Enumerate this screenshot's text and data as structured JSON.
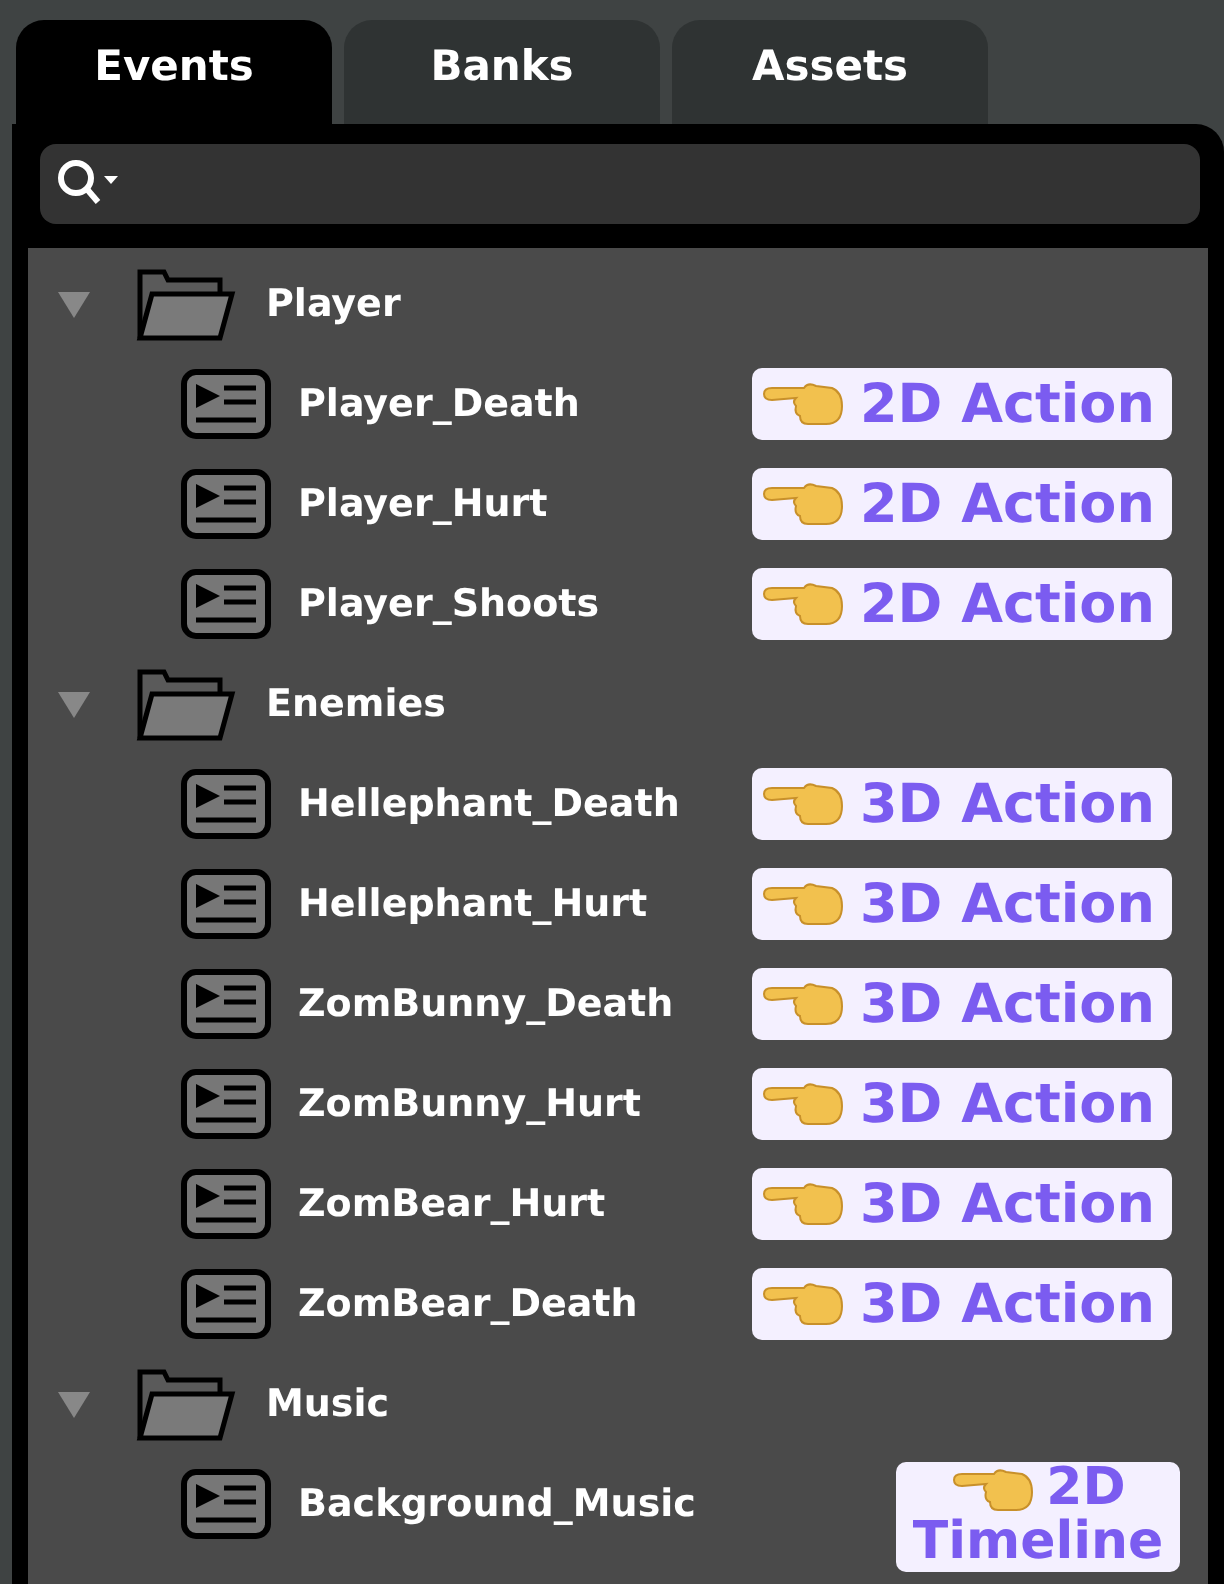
{
  "tabs": [
    {
      "label": "Events",
      "selected": true
    },
    {
      "label": "Banks",
      "selected": false
    },
    {
      "label": "Assets",
      "selected": false
    }
  ],
  "tree": [
    {
      "label": "Player",
      "expanded": true,
      "children": [
        {
          "label": "Player_Death",
          "tag": "2D Action"
        },
        {
          "label": "Player_Hurt",
          "tag": "2D Action"
        },
        {
          "label": "Player_Shoots",
          "tag": "2D Action"
        }
      ]
    },
    {
      "label": "Enemies",
      "expanded": true,
      "children": [
        {
          "label": "Hellephant_Death",
          "tag": "3D Action"
        },
        {
          "label": "Hellephant_Hurt",
          "tag": "3D Action"
        },
        {
          "label": "ZomBunny_Death",
          "tag": "3D Action"
        },
        {
          "label": "ZomBunny_Hurt",
          "tag": "3D Action"
        },
        {
          "label": "ZomBear_Hurt",
          "tag": "3D Action"
        },
        {
          "label": "ZomBear_Death",
          "tag": "3D Action"
        }
      ]
    },
    {
      "label": "Music",
      "expanded": true,
      "children": [
        {
          "label": "Background_Music",
          "tag": "2D Timeline"
        }
      ]
    }
  ]
}
